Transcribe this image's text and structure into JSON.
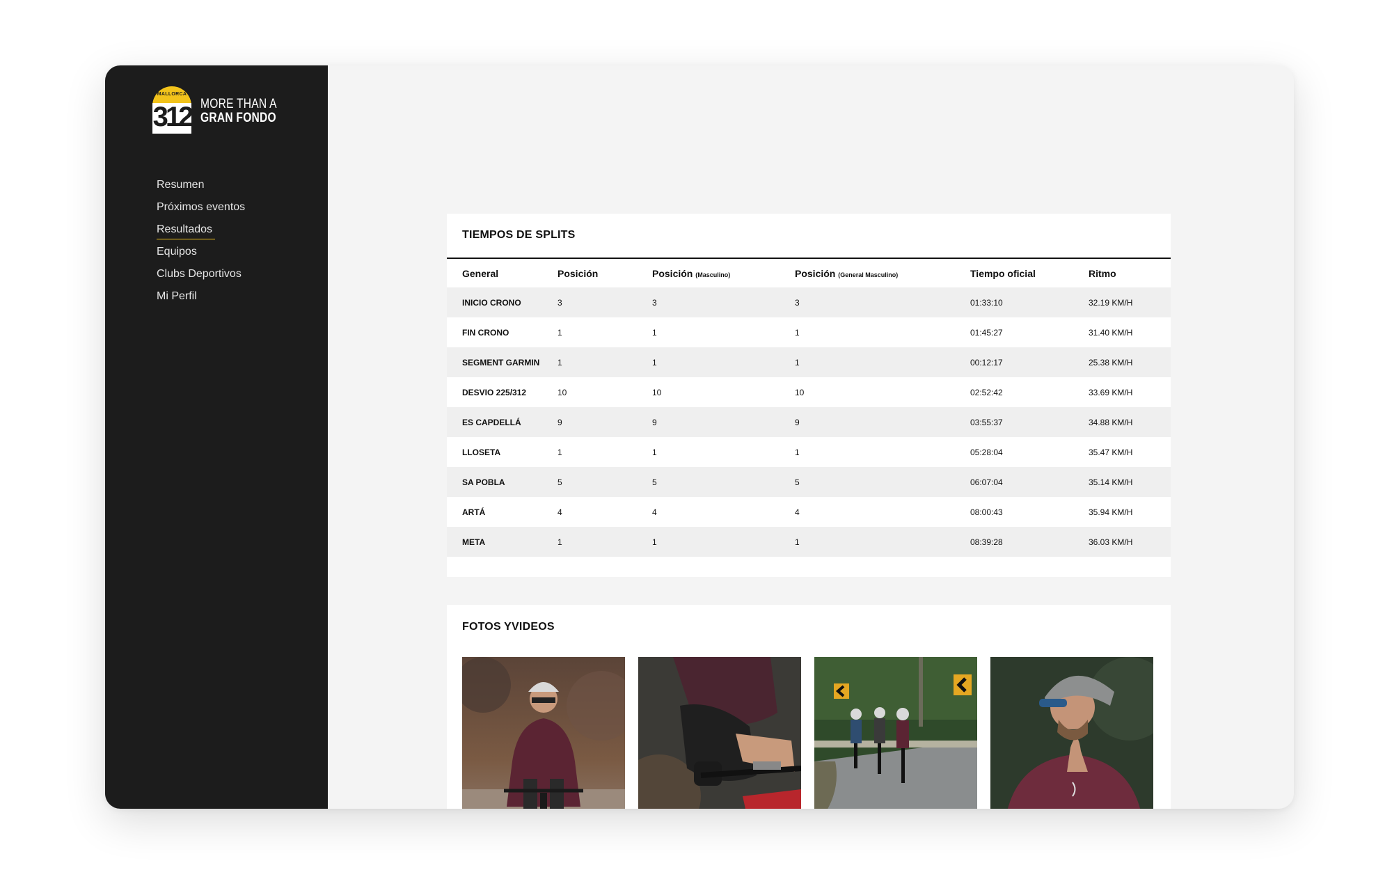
{
  "brand": {
    "badge_top": "MALLORCA",
    "badge_number": "312",
    "line1": "MORE THAN A",
    "line2": "GRAN FONDO",
    "accent_color": "#f2c31b"
  },
  "sidebar": {
    "items": [
      {
        "label": "Resumen"
      },
      {
        "label": "Próximos eventos"
      },
      {
        "label": "Resultados",
        "active": true
      },
      {
        "label": "Equipos"
      },
      {
        "label": "Clubs Deportivos"
      },
      {
        "label": "Mi Perfil"
      }
    ]
  },
  "splits": {
    "title": "TIEMPOS DE SPLITS",
    "headers": {
      "general": "General",
      "posicion": "Posición",
      "posicion_masc": "Posición",
      "posicion_masc_sub": "(Masculino)",
      "posicion_gen_masc": "Posición",
      "posicion_gen_masc_sub": "(General Masculino)",
      "tiempo": "Tiempo oficial",
      "ritmo": "Ritmo"
    },
    "rows": [
      {
        "name": "INICIO CRONO",
        "pos": "3",
        "pos_m": "3",
        "pos_gm": "3",
        "time": "01:33:10",
        "pace": "32.19 KM/H"
      },
      {
        "name": "FIN CRONO",
        "pos": "1",
        "pos_m": "1",
        "pos_gm": "1",
        "time": "01:45:27",
        "pace": "31.40 KM/H"
      },
      {
        "name": "SEGMENT GARMIN",
        "pos": "1",
        "pos_m": "1",
        "pos_gm": "1",
        "time": "00:12:17",
        "pace": "25.38 KM/H"
      },
      {
        "name": "DESVIO 225/312",
        "pos": "10",
        "pos_m": "10",
        "pos_gm": "10",
        "time": "02:52:42",
        "pace": "33.69 KM/H"
      },
      {
        "name": "ES CAPDELLÁ",
        "pos": "9",
        "pos_m": "9",
        "pos_gm": "9",
        "time": "03:55:37",
        "pace": "34.88 KM/H"
      },
      {
        "name": "LLOSETA",
        "pos": "1",
        "pos_m": "1",
        "pos_gm": "1",
        "time": "05:28:04",
        "pace": "35.47 KM/H"
      },
      {
        "name": "SA POBLA",
        "pos": "5",
        "pos_m": "5",
        "pos_gm": "5",
        "time": "06:07:04",
        "pace": "35.14 KM/H"
      },
      {
        "name": "ARTÁ",
        "pos": "4",
        "pos_m": "4",
        "pos_gm": "4",
        "time": "08:00:43",
        "pace": "35.94 KM/H"
      },
      {
        "name": "META",
        "pos": "1",
        "pos_m": "1",
        "pos_gm": "1",
        "time": "08:39:28",
        "pace": "36.03 KM/H"
      }
    ]
  },
  "photos": {
    "title": "FOTOS YVIDEOS",
    "items": [
      {
        "icon": "cyclist-riding-photo"
      },
      {
        "icon": "cyclist-closeup-photo"
      },
      {
        "icon": "cyclists-group-road-photo"
      },
      {
        "icon": "cyclist-portrait-photo"
      }
    ]
  }
}
